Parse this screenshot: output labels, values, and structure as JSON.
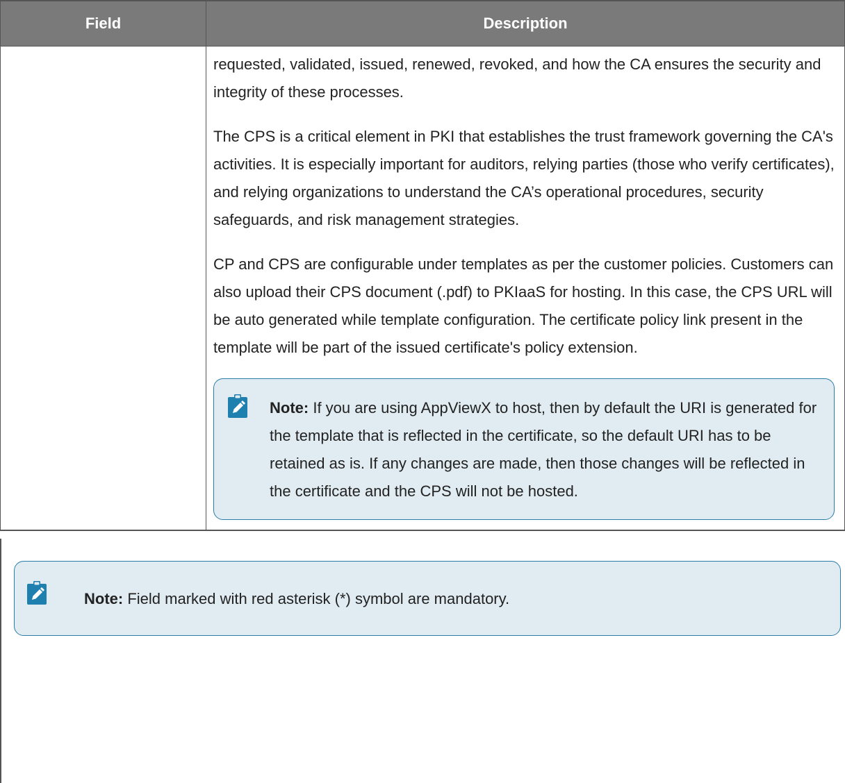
{
  "table": {
    "headers": [
      "Field",
      "Description"
    ],
    "field_cell": "",
    "paragraphs": [
      "requested, validated, issued, renewed, revoked, and how the CA ensures the security and integrity of these processes.",
      "The CPS is a critical element in PKI that establishes the trust framework governing the CA's activities. It is especially important for auditors, relying parties (those who verify certificates), and relying organizations to understand the CA’s operational procedures, security safeguards, and risk management strategies.",
      "CP and CPS are configurable under templates as per the customer policies. Customers can also upload their CPS document (.pdf) to PKIaaS for hosting. In this case, the CPS URL will be auto generated while template configuration. The certificate policy link present in the template will be part of the issued certificate's policy extension."
    ],
    "note": {
      "label": "Note:",
      "text": " If you are using AppViewX to host, then by default the URI is generated for the template that is reflected in the certificate, so the default URI has to be retained as is. If any changes are made, then those changes will be reflected in the certificate and the CPS will not be hosted."
    }
  },
  "bottom_note": {
    "label": "Note:",
    "text": " Field marked with red asterisk (*) symbol are mandatory."
  },
  "colors": {
    "header_bg": "#7a7a7a",
    "note_bg": "#e1ecf2",
    "note_border": "#2a7ca8",
    "icon_color": "#1f7fae"
  },
  "icons": {
    "note_icon": "pencil-note-icon"
  }
}
